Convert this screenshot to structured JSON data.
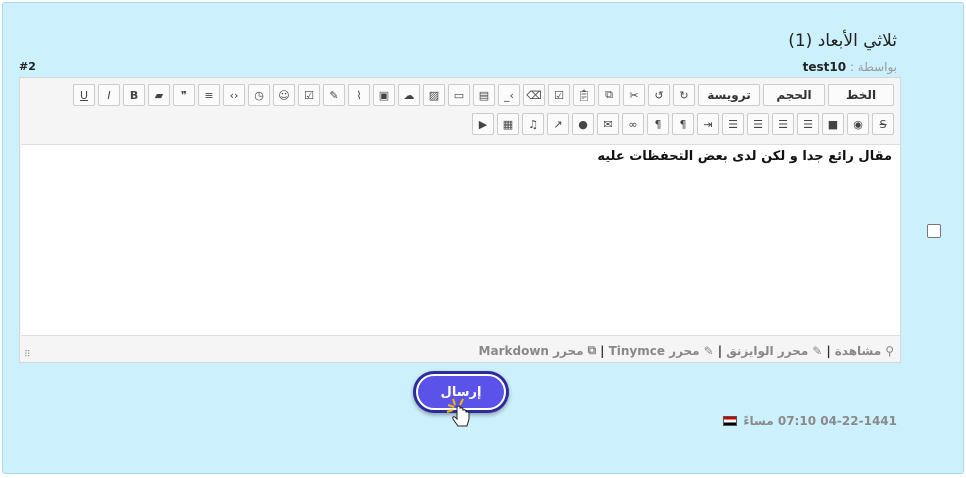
{
  "post": {
    "title": "ثلاثي الأبعاد (1)",
    "by_label": "بواسطة :",
    "author": "test10",
    "number": "#2",
    "date": "04-22-1441 07:10 مساءً"
  },
  "toolbar": {
    "font_label": "الخط",
    "size_label": "الحجم",
    "heading_label": "ترويسة"
  },
  "editor": {
    "content": "مقال رائع جدا و لكن لدى بعض التحفظات عليه",
    "resize_grip": "⠿"
  },
  "modes": {
    "preview": "مشاهدة",
    "wysiwyg": "محرر الوايزنق",
    "tinymce": "محرر Tinymce",
    "markdown": "محرر Markdown",
    "separator": "|"
  },
  "actions": {
    "send_label": "إرسال"
  },
  "colors": {
    "panel_bg": "#cdf0fd",
    "send_button": "#5b53e9",
    "send_border": "#2b2b9e"
  }
}
